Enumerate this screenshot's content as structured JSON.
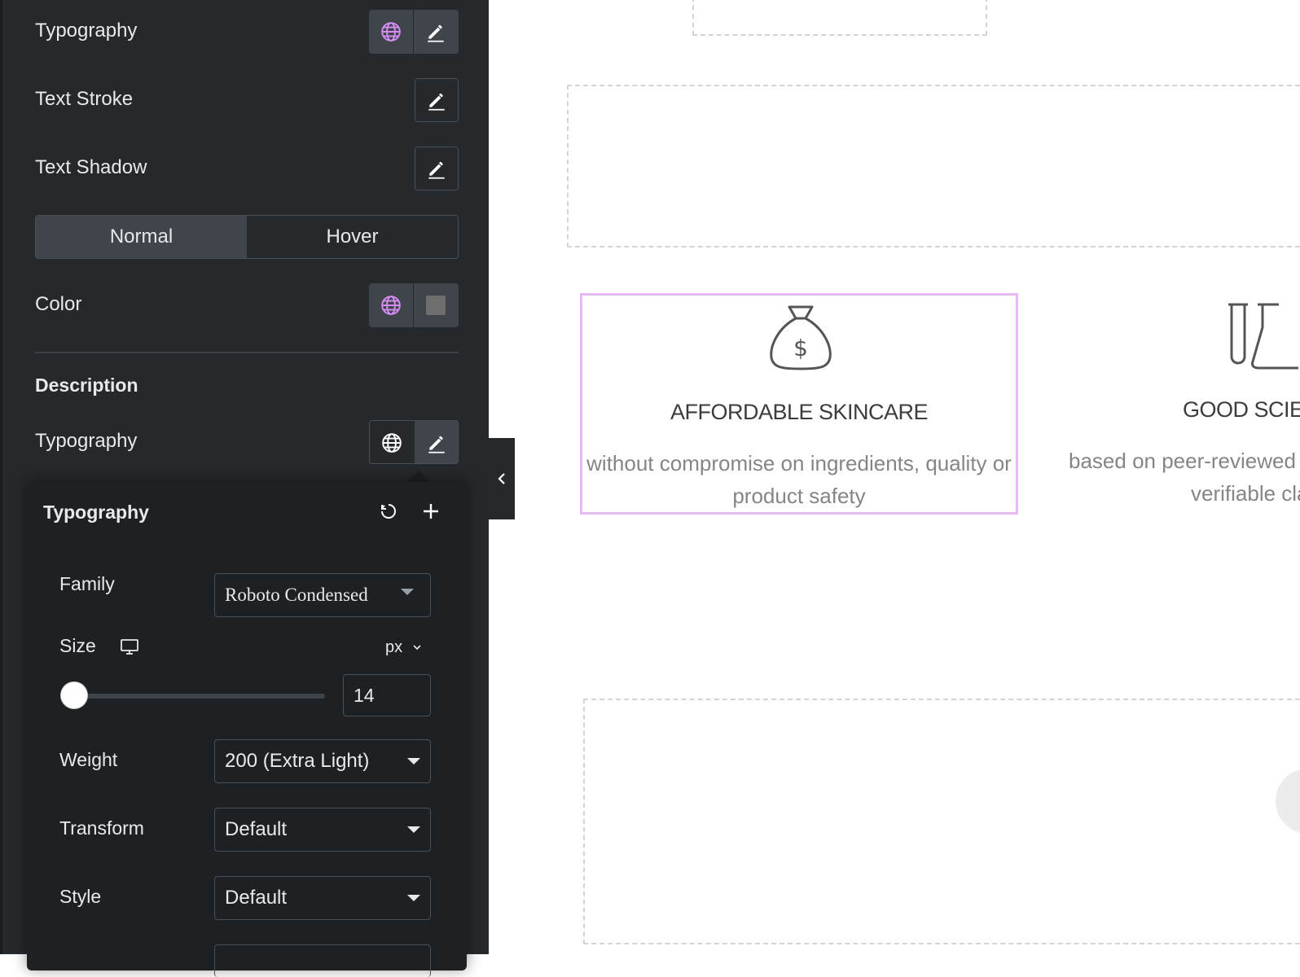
{
  "panel": {
    "title_typography": "Typography",
    "text_stroke": "Text Stroke",
    "text_shadow": "Text Shadow",
    "tabs": [
      "Normal",
      "Hover"
    ],
    "color_label": "Color",
    "color_value": "#6e6e6e",
    "section_description": "Description",
    "desc_typography": "Typography"
  },
  "popover": {
    "title": "Typography",
    "family_label": "Family",
    "family_value": "Roboto Condensed",
    "size_label": "Size",
    "size_unit": "px",
    "size_value": "14",
    "weight_label": "Weight",
    "weight_value": "200 (Extra Light)",
    "transform_label": "Transform",
    "transform_value": "Default",
    "style_label": "Style",
    "style_value": "Default"
  },
  "canvas": {
    "feature_1": {
      "icon": "money-bag-icon",
      "title": "AFFORDABLE SKINCARE",
      "desc_line1": "without compromise on ingredients, quality or",
      "desc_line2": "product safety"
    },
    "feature_2": {
      "icon": "lab-flask-icon",
      "title": "GOOD SCIE",
      "desc_line1": "based on peer-reviewed sc",
      "desc_line2": "verifiable cla"
    }
  },
  "colors": {
    "accent_globe": "#d48cf2",
    "selection_border": "#e7b8f4",
    "panel_bg": "#26292c"
  }
}
